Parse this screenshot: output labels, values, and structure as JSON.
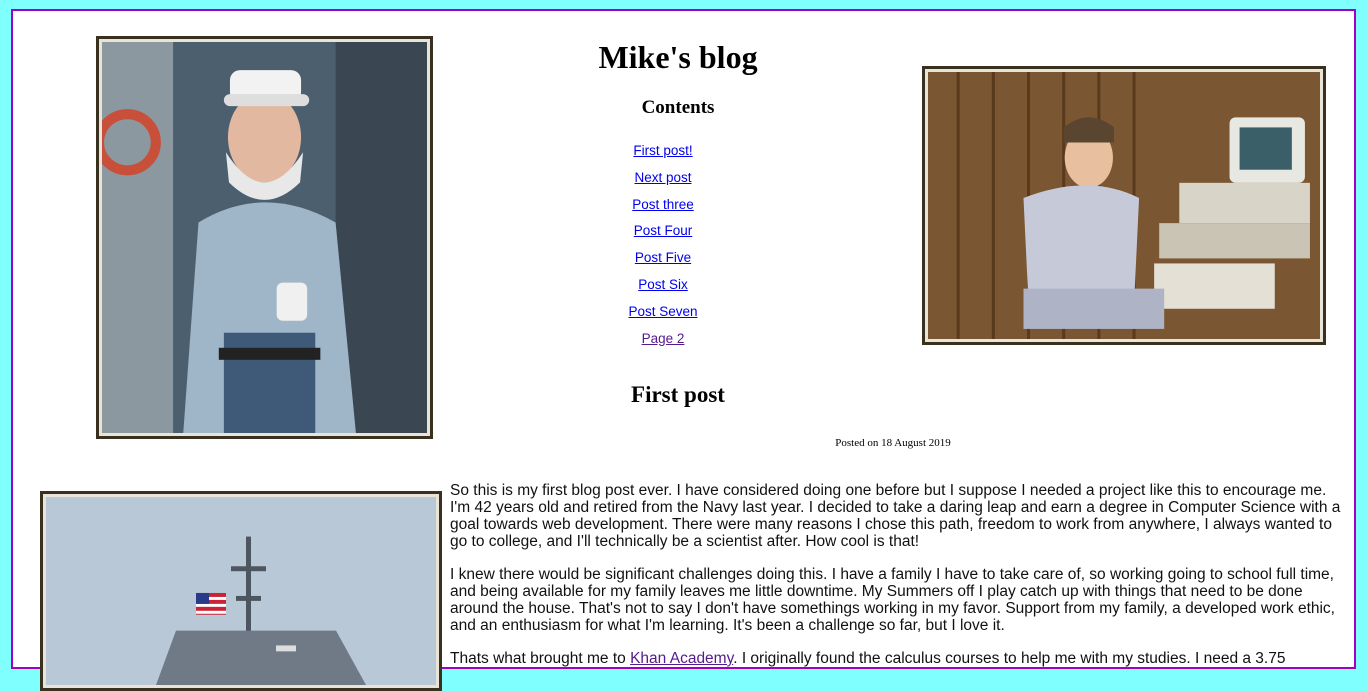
{
  "blog": {
    "title": "Mike's blog",
    "contents_heading": "Contents",
    "nav": [
      {
        "label": "First post!",
        "visited": false
      },
      {
        "label": "Next post",
        "visited": false
      },
      {
        "label": "Post three",
        "visited": false
      },
      {
        "label": "Post Four",
        "visited": false
      },
      {
        "label": "Post Five",
        "visited": false
      },
      {
        "label": "Post Six",
        "visited": false
      },
      {
        "label": "Post Seven",
        "visited": false
      },
      {
        "label": "Page 2",
        "visited": true
      }
    ]
  },
  "post": {
    "title": "First post",
    "date": "Posted on 18 August 2019",
    "paragraph1": "So this is my first blog post ever. I have considered doing one before but I suppose I needed a project like this to encourage me. I'm 42 years old and retired from the Navy last year. I decided to take a daring leap and earn a degree in Computer Science with a goal towards web development. There were many reasons I chose this path, freedom to work from anywhere, I always wanted to go to college, and I'll technically be a scientist after. How cool is that!",
    "paragraph2": "I knew there would be significant challenges doing this. I have a family I have to take care of, so working going to school full time, and being available for my family leaves me little downtime. My Summers off I play catch up with things that need to be done around the house. That's not to say I don't have somethings working in my favor. Support from my family, a developed work ethic, and an enthusiasm for what I'm learning. It's been a challenge so far, but I love it.",
    "paragraph3_before": "Thats what brought me to ",
    "paragraph3_link": "Khan Academy",
    "paragraph3_after": ". I originally found the calculus courses to help me with my studies. I need a 3.75"
  },
  "colors": {
    "background": "#80ffff",
    "page_border": "#a000c8",
    "link": "#0000ee",
    "visited_link": "#551a8b"
  }
}
